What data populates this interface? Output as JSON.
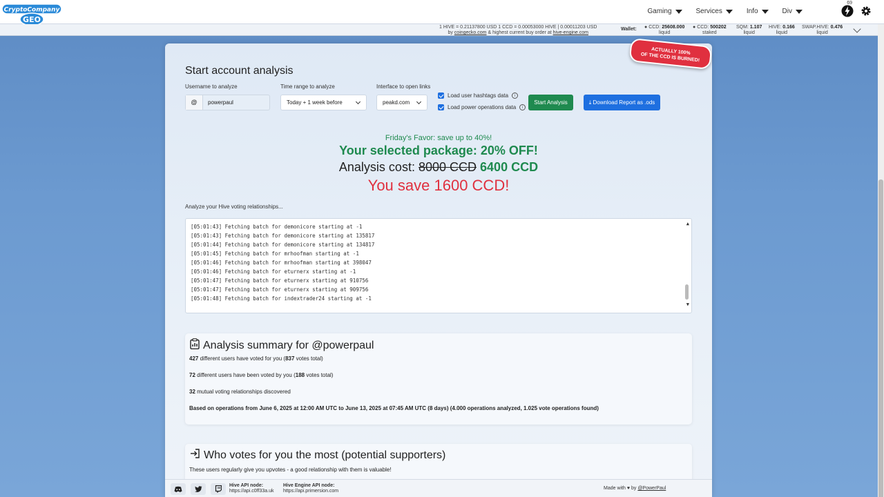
{
  "nav": {
    "logo_text_top": "CryptoCompany",
    "logo_text_bottom": "GEO",
    "menu": [
      {
        "label": "Gaming"
      },
      {
        "label": "Services"
      },
      {
        "label": "Info"
      },
      {
        "label": "Div"
      }
    ],
    "notification_count": "69"
  },
  "ticker": {
    "rate_line1": "1 HIVE = 0.21137800 USD    1 CCD = 0.00053000 HIVE | 0.00011203 USD",
    "rate_line2_prefix": "by",
    "rate_link1": "coingecko.com",
    "rate_line2_mid": "& highest current buy order at",
    "rate_link2": "hive-engine.com",
    "wallet_label": "Wallet:",
    "stats": [
      {
        "label": "CCD:",
        "value": "25608.000",
        "sub": "liquid"
      },
      {
        "label": "CCD:",
        "value": "500202",
        "sub": "staked"
      },
      {
        "label": "SQM:",
        "value": "1.107",
        "sub": "liquid"
      },
      {
        "label": "HIVE:",
        "value": "0.166",
        "sub": "liquid"
      },
      {
        "label": "SWAP.HIVE:",
        "value": "0.476",
        "sub": "liquid"
      }
    ]
  },
  "burn_badge": {
    "line1": "ACTUALLY 100%",
    "line2": "OF THE CCD IS BURNED!"
  },
  "form": {
    "title": "Start account analysis",
    "username_label": "Username to analyze",
    "username_prefix": "@",
    "username_value": "powerpaul",
    "time_label": "Time range to analyze",
    "time_value": "Today + 1 week before",
    "interface_label": "Interface to open links",
    "interface_value": "peakd.com",
    "chk_hashtags": "Load user hashtags data",
    "chk_power": "Load power operations data",
    "start_button": "Start Analysis",
    "download_button": "Download Report as .ods"
  },
  "promo": {
    "line1": "Friday's Favor: save up to 40%!",
    "line2": "Your selected package: 20% OFF!",
    "cost_label": "Analysis cost:",
    "old_price": "8000 CCD",
    "new_price": "6400 CCD",
    "savings": "You save 1600 CCD!"
  },
  "log": {
    "label": "Analyze your Hive voting relationships...",
    "lines": [
      "[05:01:43] Fetching batch for demonicore starting at -1",
      "[05:01:43] Fetching batch for demonicore starting at 135817",
      "[05:01:44] Fetching batch for demonicore starting at 134817",
      "[05:01:45] Fetching batch for mrhoofman starting at -1",
      "[05:01:46] Fetching batch for mrhoofman starting at 398047",
      "[05:01:46] Fetching batch for eturnerx starting at -1",
      "[05:01:47] Fetching batch for eturnerx starting at 910756",
      "[05:01:47] Fetching batch for eturnerx starting at 909756",
      "[05:01:48] Fetching batch for indextrader24 starting at -1"
    ]
  },
  "summary": {
    "title": "Analysis summary for @powerpaul",
    "s1_num": "427",
    "s1_text": "different users have voted for you (",
    "s1_votes": "837",
    "s1_end": "votes total)",
    "s2_num": "72",
    "s2_text": "different users have been voted by you (",
    "s2_votes": "188",
    "s2_end": "votes total)",
    "s3_num": "32",
    "s3_text": "mutual voting relationships discovered",
    "based_on": "Based on operations from June 6, 2025 at 12:00 AM UTC to June 13, 2025 at 07:45 AM UTC (8 days) (4.000 operations analyzed, 1.025 vote operations found)"
  },
  "supporters": {
    "title": "Who votes for you the most (potential supporters)",
    "subtitle": "These users regularly give you upvotes - a good relationship with them is valuable!"
  },
  "footer": {
    "hive_api_label": "Hive API node:",
    "hive_api_value": "https://api.c0ff33a.uk",
    "he_api_label": "Hive Engine API node:",
    "he_api_value": "https://api.primersion.com",
    "made_with": "Made with",
    "made_by": "by",
    "author": "@PowerPaul"
  }
}
